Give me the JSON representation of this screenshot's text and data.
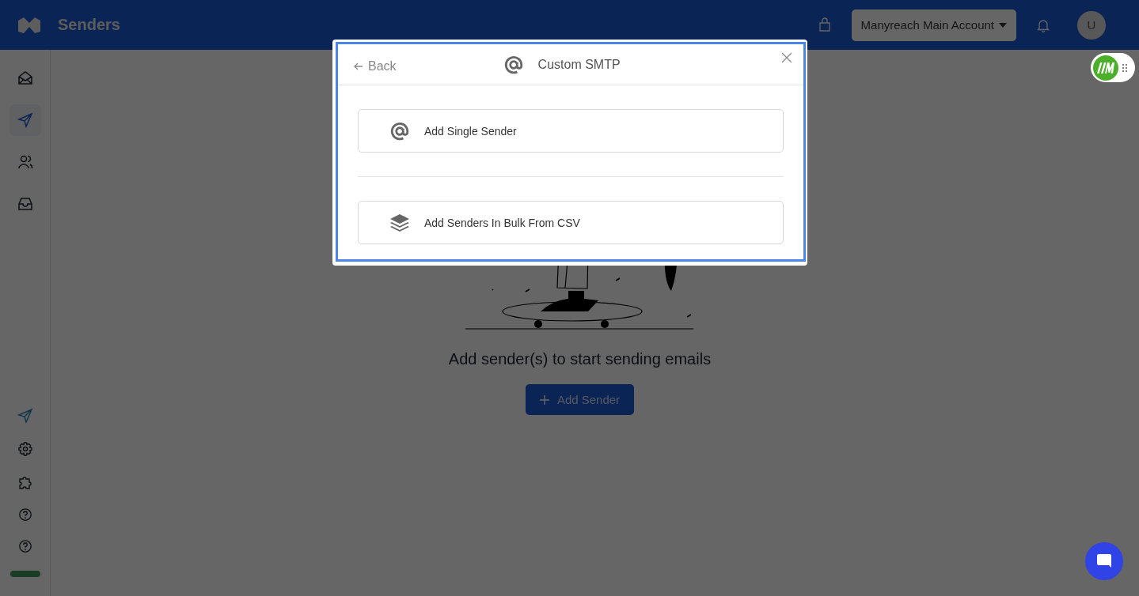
{
  "header": {
    "title": "Senders",
    "account": "Manyreach Main Account",
    "avatar": "U"
  },
  "sidebar": {
    "items": [
      {
        "selected": false
      },
      {
        "selected": true
      },
      {
        "selected": false
      },
      {
        "selected": false
      }
    ]
  },
  "main": {
    "message": "Add sender(s) to start sending emails",
    "button": "Add Sender"
  },
  "modal": {
    "back": "Back",
    "title": "Custom SMTP",
    "options": [
      {
        "label": "Add Single Sender",
        "kind": "single"
      },
      {
        "label": "Add Senders In Bulk From CSV",
        "kind": "bulk"
      }
    ]
  }
}
